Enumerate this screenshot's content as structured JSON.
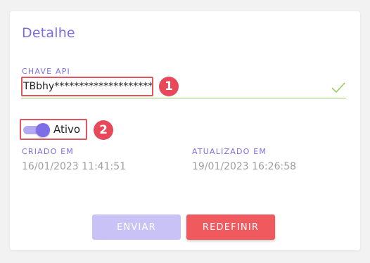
{
  "card": {
    "title": "Detalhe",
    "api_key": {
      "label": "CHAVE API",
      "value": "TBbhy*********************"
    },
    "status_toggle": {
      "label": "Ativo",
      "checked": true
    },
    "created": {
      "label": "CRIADO EM",
      "value": "16/01/2023 11:41:51"
    },
    "updated": {
      "label": "ATUALIZADO EM",
      "value": "19/01/2023 16:26:58"
    },
    "buttons": {
      "send": "ENVIAR",
      "reset": "REDEFINIR"
    }
  },
  "annotations": {
    "marker_1": "1",
    "marker_2": "2"
  },
  "icons": {
    "valid": "check-icon"
  },
  "colors": {
    "accent": "#7d6ee7",
    "valid": "#9ccc65",
    "highlight": "#e05560",
    "reset_button": "#f05a5e",
    "send_button_disabled": "#c9c2f7"
  }
}
